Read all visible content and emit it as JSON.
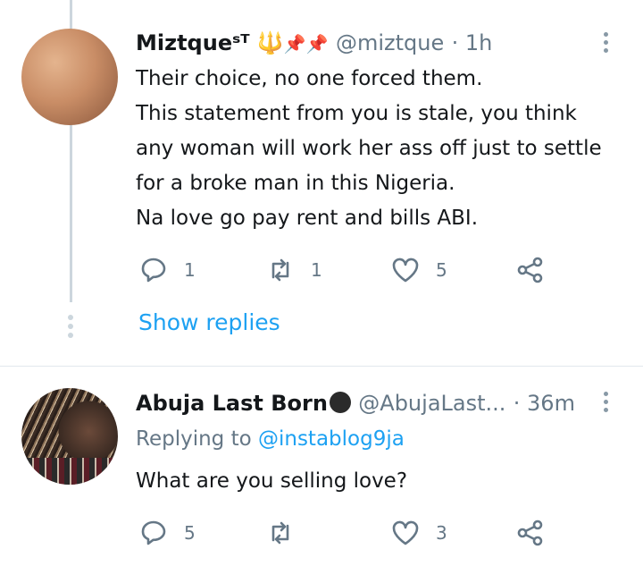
{
  "tweet1": {
    "name": "Miztqueˢᵀⁱᵁⁱⁱⁱⁱⁱⁱⁱⁱⁱⁱⁱⁱⁱⁱⁱⁱⁱⁱⁱ",
    "name_display": "Miztqueˢᵀ",
    "handle": "@miztque",
    "time": "· 1h",
    "text": "Their choice, no one forced them.\nThis statement from you is stale, you think any woman will work her ass off just to settle for a broke man in this Nigeria.\nNa love go pay rent and bills ABI.",
    "replies": "1",
    "retweets": "1",
    "likes": "5",
    "show_replies": "Show replies"
  },
  "tweet2": {
    "name": "Abuja Last Born",
    "handle": "@AbujaLast...",
    "time": "· 36m",
    "replying_prefix": "Replying to",
    "replying_to": "@instablog9ja",
    "text": "What are you selling love?",
    "replies": "5",
    "retweets": "",
    "likes": "3"
  },
  "colors": {
    "accent": "#1da1f2",
    "muted": "#657786",
    "thread": "#ccd6dd"
  }
}
